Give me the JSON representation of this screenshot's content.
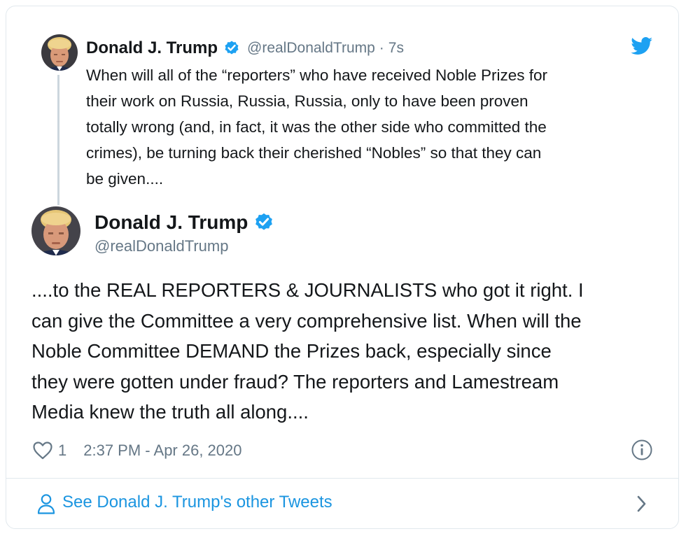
{
  "parent_tweet": {
    "author_name": "Donald J. Trump",
    "handle": "@realDonaldTrump",
    "separator": "·",
    "time_ago": "7s",
    "text": "When will all of the “reporters” who have received Noble Prizes for\ntheir work on Russia, Russia, Russia, only to have been proven\ntotally wrong (and, in fact, it was the other side who committed the\ncrimes), be turning back their cherished “Nobles” so that they can\nbe given...."
  },
  "main_tweet": {
    "author_name": "Donald J. Trump",
    "handle": "@realDonaldTrump",
    "text": "....to the REAL REPORTERS & JOURNALISTS who got it right. I\ncan give the Committee a very comprehensive list. When will the\nNoble Committee DEMAND the Prizes back, especially since\nthey were gotten under fraud? The reporters and Lamestream\nMedia knew the truth all along....",
    "like_count": "1",
    "timestamp": "2:37 PM - Apr 26, 2020"
  },
  "footer": {
    "link_label": "See Donald J. Trump's other Tweets"
  },
  "icons": {
    "verified": "verified-badge-icon",
    "brand": "twitter-bird-icon",
    "like": "heart-icon",
    "info": "info-icon",
    "profile": "person-icon",
    "navigate": "chevron-right-icon"
  },
  "colors": {
    "twitter_blue": "#1da1f2",
    "link_blue": "#1b95e0",
    "text_primary": "#14171a",
    "text_secondary": "#657786",
    "border": "#e1e8ed",
    "thread_line": "#ccd6dd"
  }
}
